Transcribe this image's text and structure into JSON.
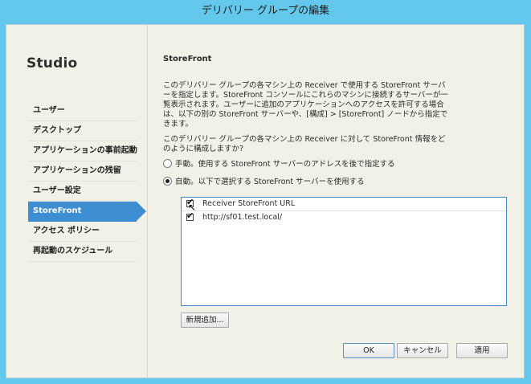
{
  "window": {
    "title": "デリバリー グループの編集"
  },
  "sidebar": {
    "app_title": "Studio",
    "items": [
      {
        "label": "ユーザー"
      },
      {
        "label": "デスクトップ"
      },
      {
        "label": "アプリケーションの事前起動"
      },
      {
        "label": "アプリケーションの残留"
      },
      {
        "label": "ユーザー設定"
      },
      {
        "label": "StoreFront",
        "active": true
      },
      {
        "label": "アクセス ポリシー"
      },
      {
        "label": "再起動のスケジュール"
      }
    ]
  },
  "main": {
    "heading": "StoreFront",
    "description": "このデリバリー グループの各マシン上の Receiver で使用する StoreFront サーバーを指定します。StoreFront コンソールにこれらのマシンに接続するサーバーが一覧表示されます。ユーザーに追加のアプリケーションへのアクセスを許可する場合は、以下の別の StoreFront サーバーや、[構成] > [StoreFront] ノードから指定できます。",
    "question": "このデリバリー グループの各マシン上の Receiver に対して StoreFront 情報をどのように構成しますか?",
    "options": [
      {
        "label": "手動。使用する StoreFront サーバーのアドレスを後で指定する",
        "selected": false
      },
      {
        "label": "自動。以下で選択する StoreFront サーバーを使用する",
        "selected": true
      }
    ],
    "url_list": {
      "header": "Receiver StoreFront URL",
      "header_checked": true,
      "rows": [
        {
          "url": "http://sf01.test.local/",
          "checked": true
        }
      ]
    },
    "add_button": "新規追加..."
  },
  "footer": {
    "ok": "OK",
    "cancel": "キャンセル",
    "apply": "適用"
  },
  "colors": {
    "titlebar": "#64c7ec",
    "accent": "#3e8ed3",
    "panel": "#f1f1e8"
  }
}
